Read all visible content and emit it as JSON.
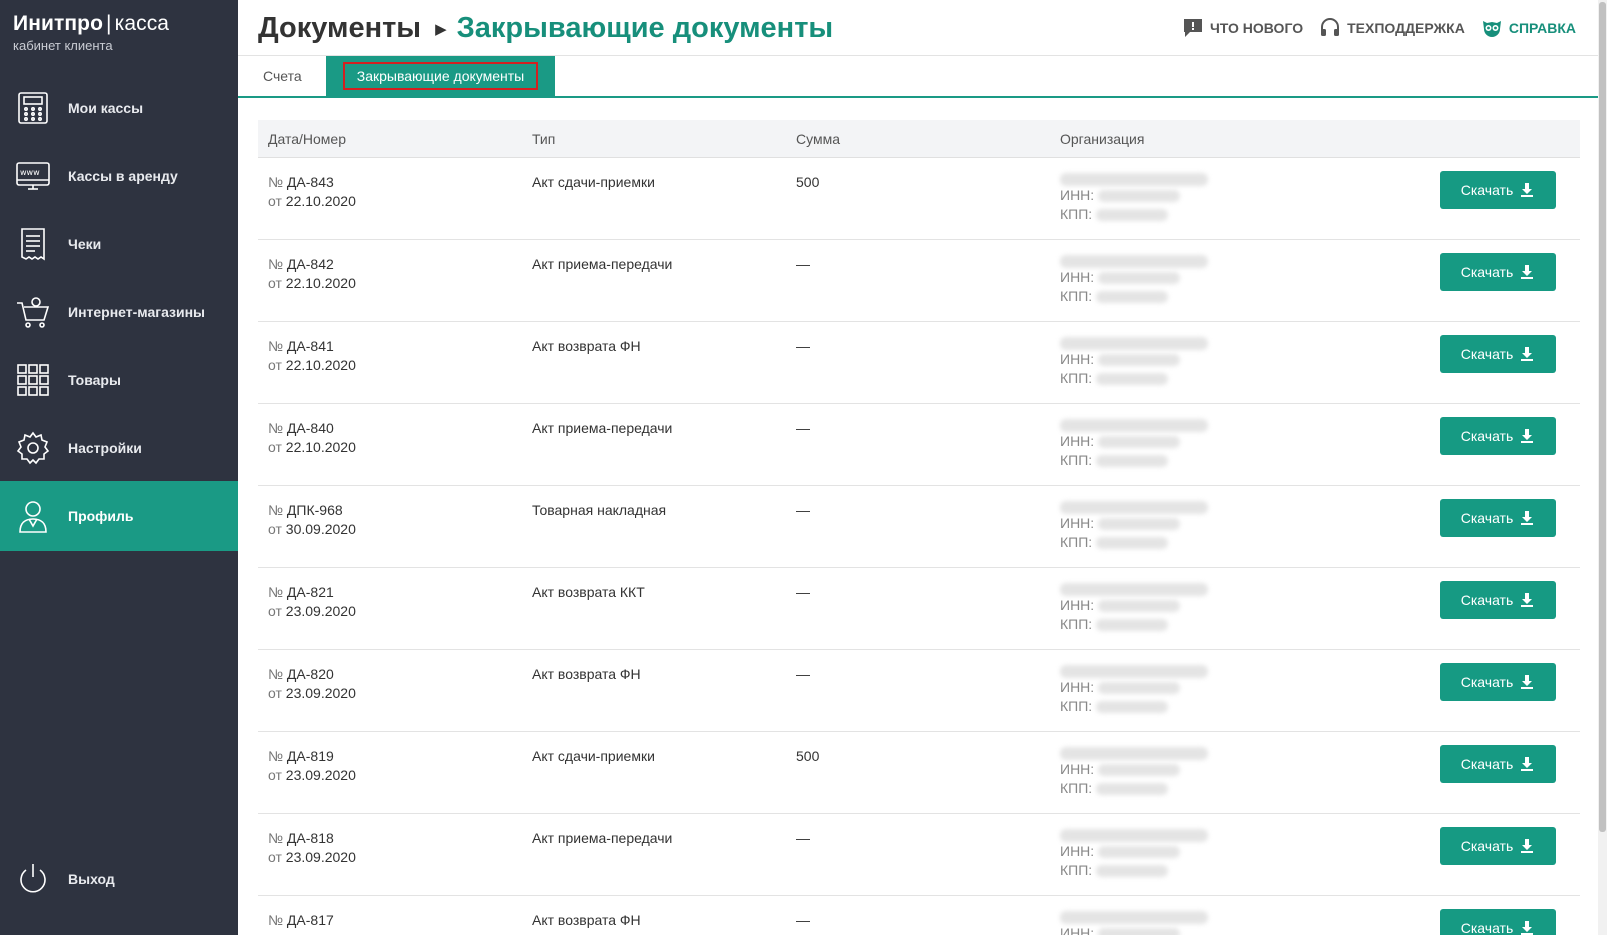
{
  "brand": {
    "name": "Инитпро",
    "separator": "|",
    "product": "касса",
    "subtitle": "кабинет клиента"
  },
  "sidebar": {
    "items": [
      {
        "label": "Мои кассы",
        "icon": "cash-register-icon"
      },
      {
        "label": "Кассы в аренду",
        "icon": "www-icon"
      },
      {
        "label": "Чеки",
        "icon": "receipt-icon"
      },
      {
        "label": "Интернет-магазины",
        "icon": "cart-icon"
      },
      {
        "label": "Товары",
        "icon": "grid-icon"
      },
      {
        "label": "Настройки",
        "icon": "gear-icon"
      },
      {
        "label": "Профиль",
        "icon": "user-icon",
        "active": true
      }
    ],
    "logout": {
      "label": "Выход",
      "icon": "power-icon"
    }
  },
  "header": {
    "crumb_root": "Документы",
    "crumb_current": "Закрывающие документы",
    "links": {
      "news": "ЧТО НОВОГО",
      "support": "ТЕХПОДДЕРЖКА",
      "help": "СПРАВКА"
    }
  },
  "tabs": {
    "accounts": "Счета",
    "closing": "Закрывающие документы"
  },
  "colors": {
    "accent": "#1a9a85",
    "sidebar": "#2e3340",
    "highlight": "#d32020"
  },
  "table": {
    "headers": {
      "number": "Дата/Номер",
      "type": "Тип",
      "sum": "Сумма",
      "org": "Организация"
    },
    "inn_label": "ИНН:",
    "kpp_label": "КПП:",
    "download_label": "Скачать",
    "no_prefix": "№",
    "date_prefix": "от",
    "rows": [
      {
        "number": "ДА-843",
        "date": "22.10.2020",
        "type": "Акт сдачи-приемки",
        "sum": "500"
      },
      {
        "number": "ДА-842",
        "date": "22.10.2020",
        "type": "Акт приема-передачи",
        "sum": "—"
      },
      {
        "number": "ДА-841",
        "date": "22.10.2020",
        "type": "Акт возврата ФН",
        "sum": "—"
      },
      {
        "number": "ДА-840",
        "date": "22.10.2020",
        "type": "Акт приема-передачи",
        "sum": "—"
      },
      {
        "number": "ДПК-968",
        "date": "30.09.2020",
        "type": "Товарная накладная",
        "sum": "—"
      },
      {
        "number": "ДА-821",
        "date": "23.09.2020",
        "type": "Акт возврата ККТ",
        "sum": "—"
      },
      {
        "number": "ДА-820",
        "date": "23.09.2020",
        "type": "Акт возврата ФН",
        "sum": "—"
      },
      {
        "number": "ДА-819",
        "date": "23.09.2020",
        "type": "Акт сдачи-приемки",
        "sum": "500"
      },
      {
        "number": "ДА-818",
        "date": "23.09.2020",
        "type": "Акт приема-передачи",
        "sum": "—"
      },
      {
        "number": "ДА-817",
        "date": "",
        "type": "Акт возврата ФН",
        "sum": "—"
      }
    ]
  }
}
